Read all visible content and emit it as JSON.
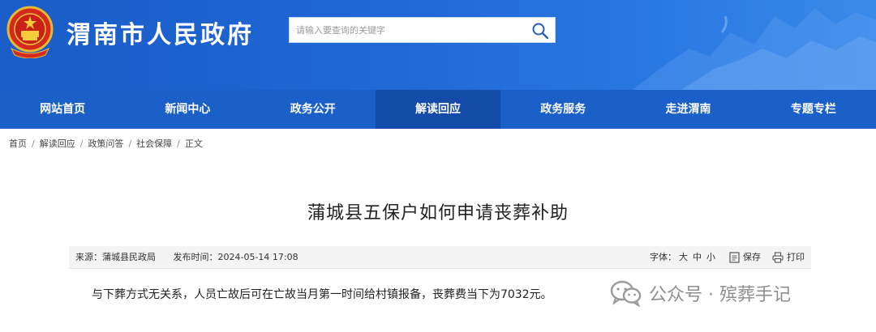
{
  "header": {
    "site_title": "渭南市人民政府",
    "search_placeholder": "请输入要查询的关键字",
    "colors": {
      "header_blue": "#1f68d6",
      "nav_blue": "#1b5fc9",
      "nav_active": "#144aa8"
    },
    "emblem_icon": "national-emblem-icon",
    "search_icon": "search-icon"
  },
  "nav": {
    "items": [
      {
        "label": "网站首页"
      },
      {
        "label": "新闻中心"
      },
      {
        "label": "政务公开"
      },
      {
        "label": "解读回应",
        "active": true
      },
      {
        "label": "政务服务"
      },
      {
        "label": "走进渭南"
      },
      {
        "label": "专题专栏"
      }
    ]
  },
  "breadcrumb": {
    "items": [
      "首页",
      "解读回应",
      "政策问答",
      "社会保障",
      "正文"
    ],
    "separator": "/"
  },
  "article": {
    "title": "蒲城县五保户如何申请丧葬补助",
    "source_label": "来源：蒲城县民政局",
    "date_label": "发布时间：2024-05-14 17:08",
    "font_size_label": "字体：",
    "font_sizes": [
      "大",
      "中",
      "小"
    ],
    "save_label": "保存",
    "print_label": "打印",
    "body": "与下葬方式无关系，人员亡故后可在亡故当月第一时间给村镇报备，丧葬费当下为7032元。"
  },
  "watermark": {
    "text": "公众号 · 殡葬手记",
    "icon": "wechat-icon"
  }
}
